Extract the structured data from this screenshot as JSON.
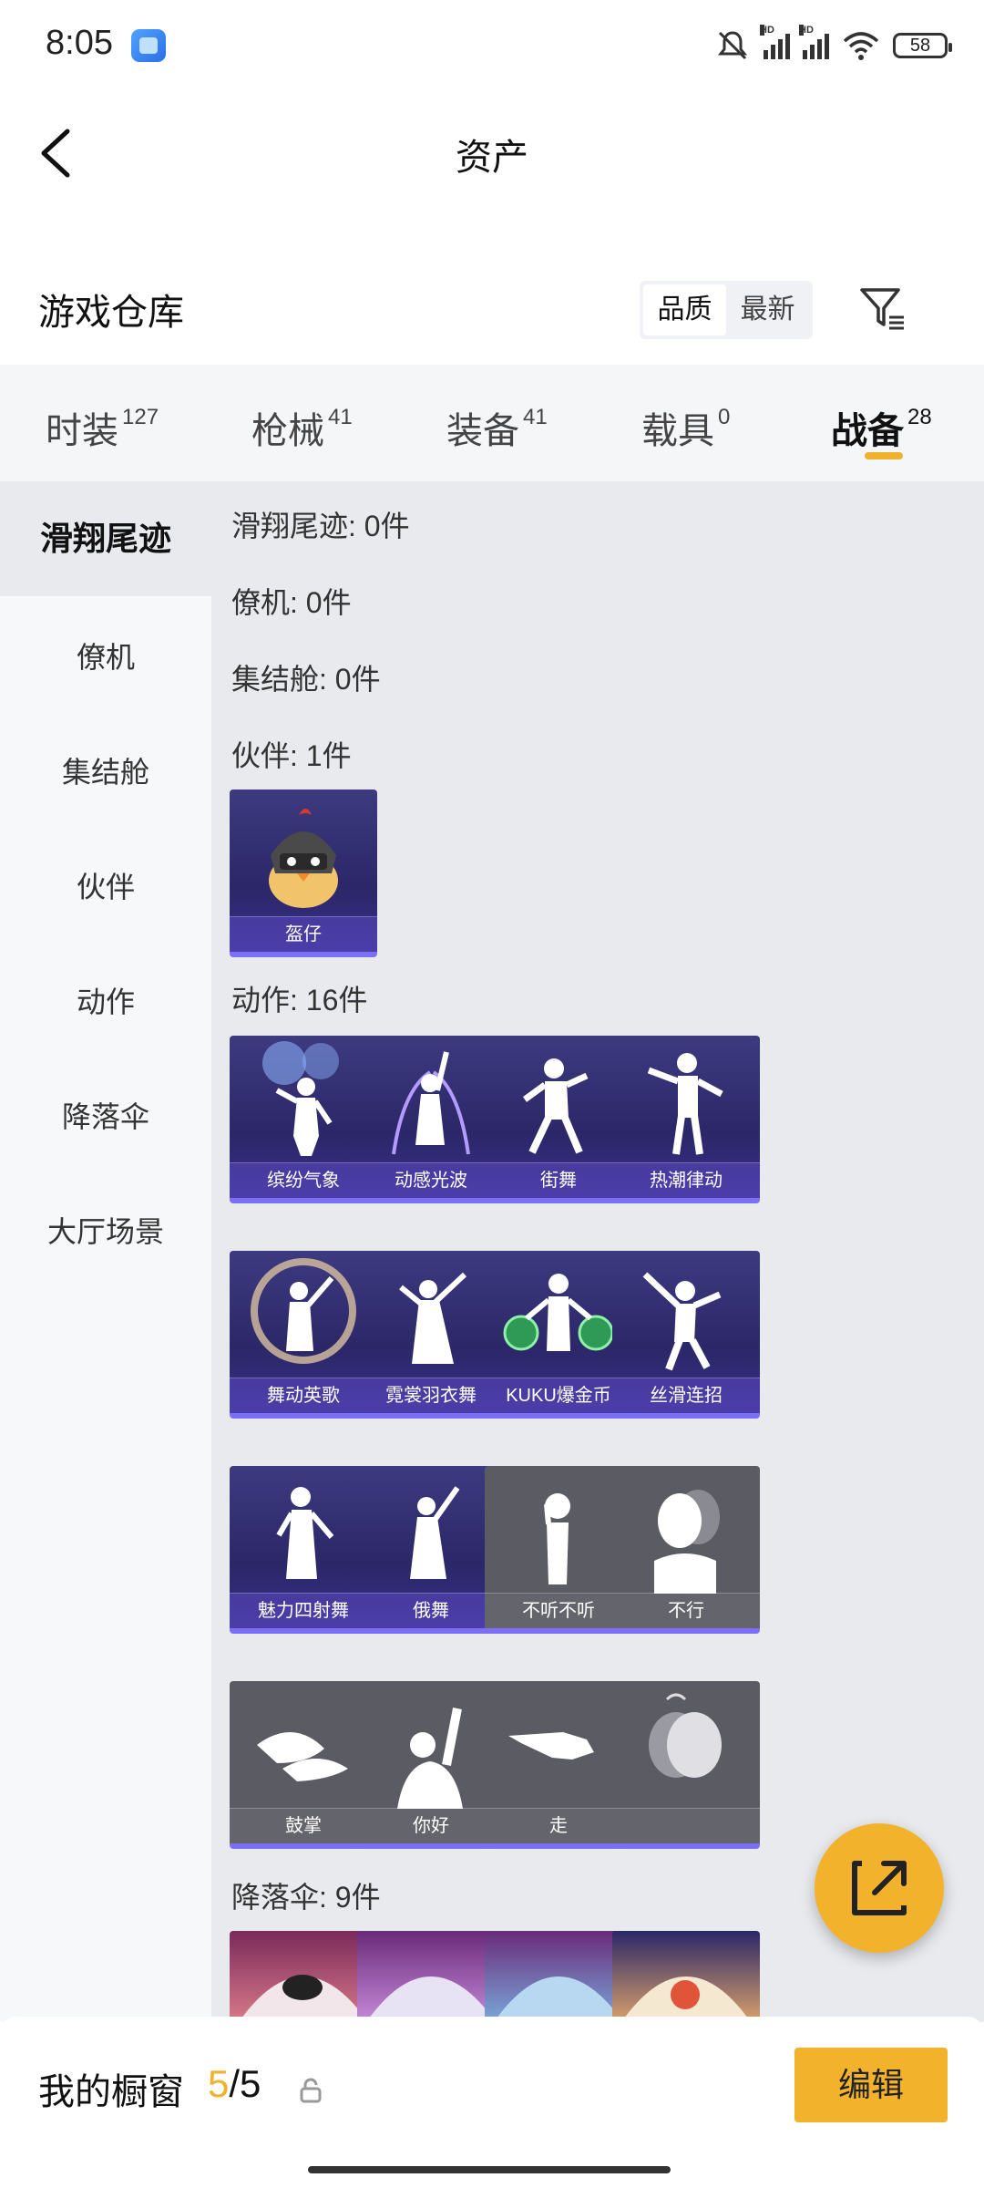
{
  "status_bar": {
    "time": "8:05",
    "battery": "58",
    "signal_label": "HD"
  },
  "nav": {
    "title": "资产"
  },
  "warehouse": {
    "title": "游戏仓库",
    "sort_options": [
      "品质",
      "最新"
    ],
    "active_sort": "品质"
  },
  "tabs": [
    {
      "label": "时装",
      "count": "127"
    },
    {
      "label": "枪械",
      "count": "41"
    },
    {
      "label": "装备",
      "count": "41"
    },
    {
      "label": "载具",
      "count": "0"
    },
    {
      "label": "战备",
      "count": "28",
      "active": true
    }
  ],
  "sidebar": {
    "items": [
      "滑翔尾迹",
      "僚机",
      "集结舱",
      "伙伴",
      "动作",
      "降落伞",
      "大厅场景"
    ]
  },
  "sections": {
    "glide_trail": "滑翔尾迹: 0件",
    "wingman": "僚机: 0件",
    "assembly_pod": "集结舱: 0件",
    "partner": "伙伴: 1件",
    "emote": "动作: 16件",
    "parachute": "降落伞: 9件"
  },
  "partner_items": [
    "盔仔"
  ],
  "emote_items": [
    "缤纷气象",
    "动感光波",
    "街舞",
    "热潮律动",
    "舞动英歌",
    "霓裳羽衣舞",
    "KUKU爆金币",
    "丝滑连招",
    "魅力四射舞",
    "俄舞",
    "不听不听",
    "不行",
    "鼓掌",
    "你好",
    "走",
    ""
  ],
  "showcase": {
    "label": "我的橱窗",
    "current": "5",
    "total": "/5",
    "edit_label": "编辑"
  },
  "colors": {
    "accent": "#f3b22b",
    "card_purple": "#2b2768",
    "card_gray": "#5b5b63",
    "rare_edge": "#7c6ef5"
  }
}
